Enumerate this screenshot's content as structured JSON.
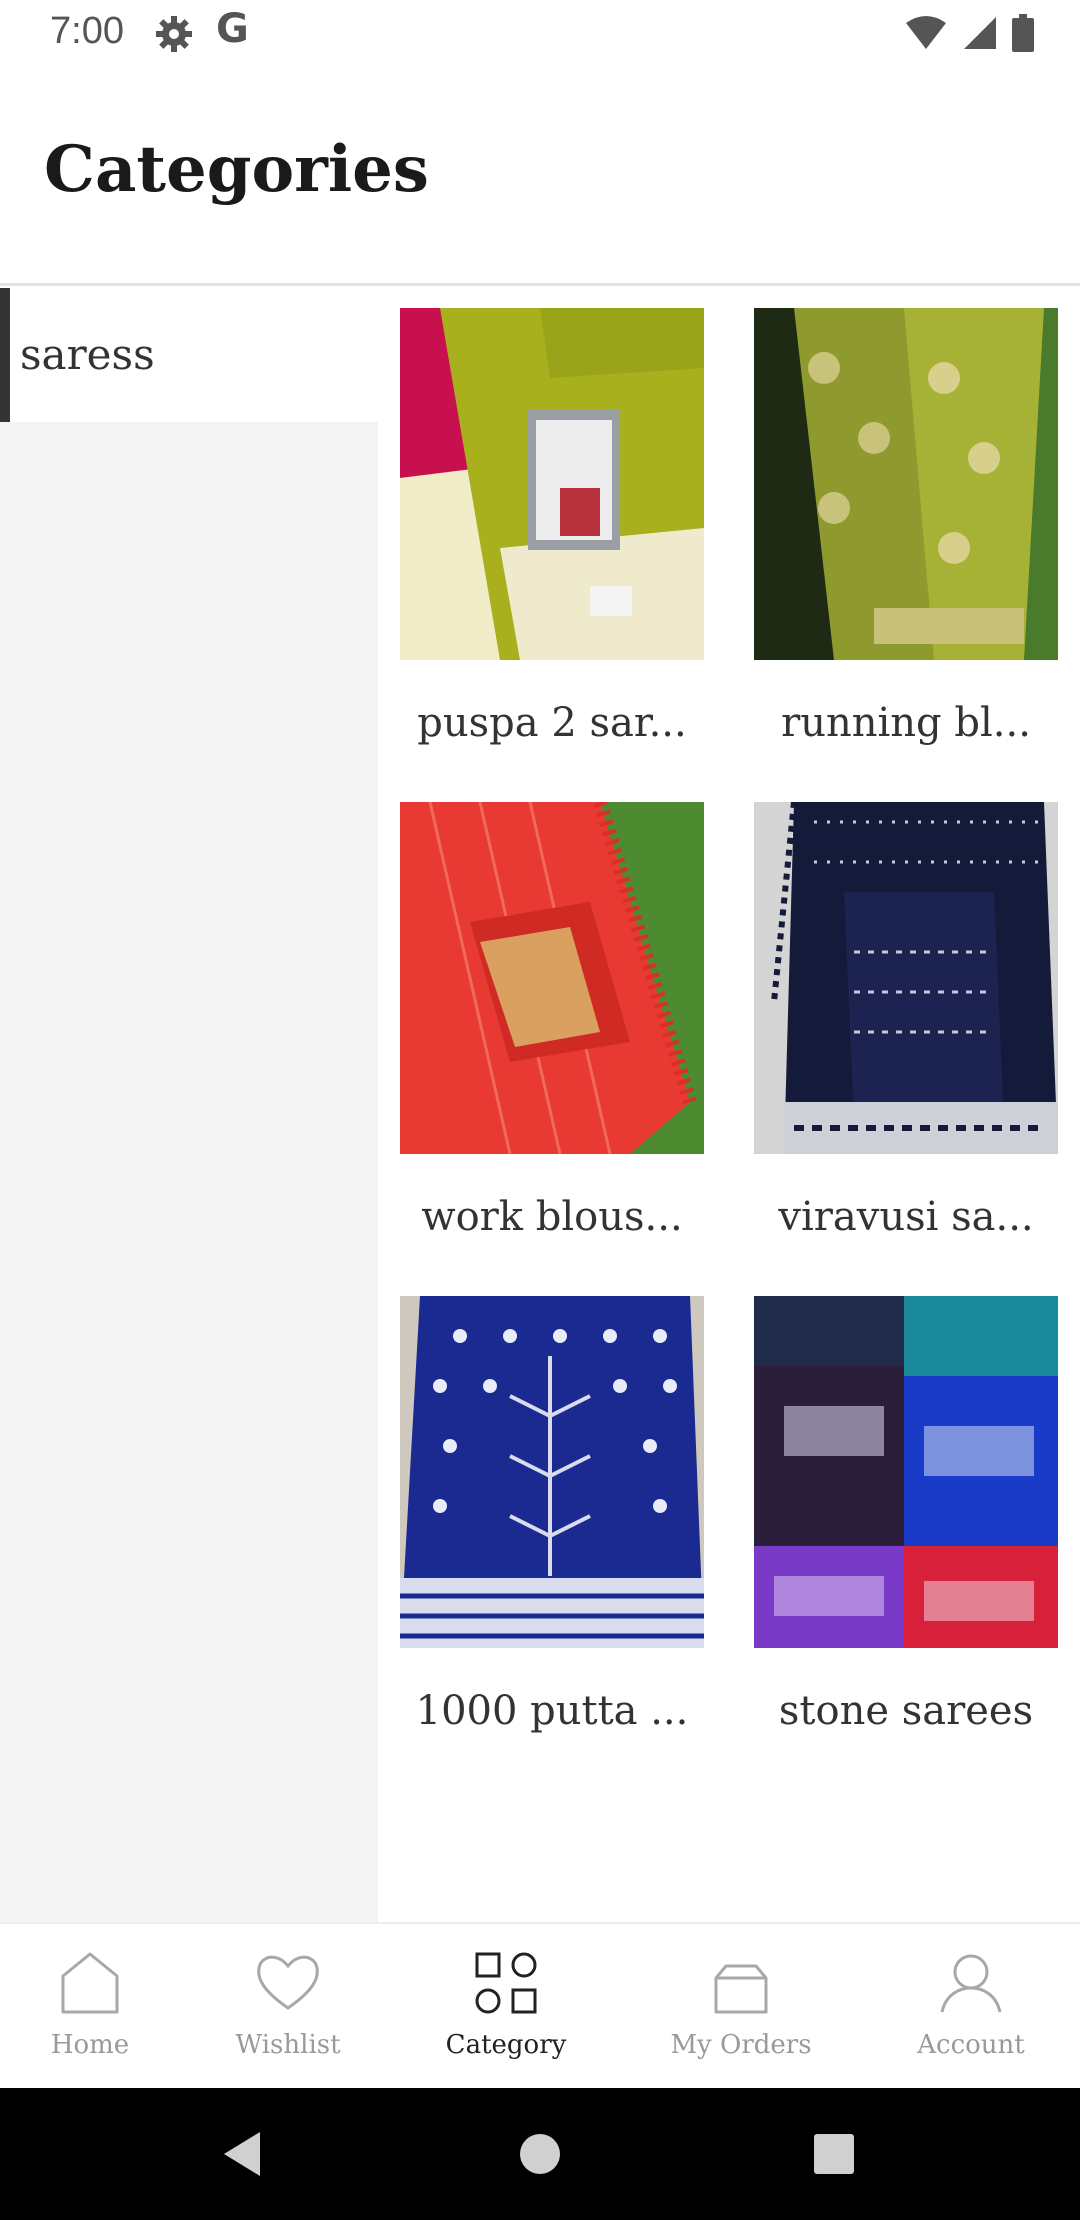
{
  "status_bar": {
    "time": "7:00",
    "left_icons": [
      "gear-icon",
      "google-icon"
    ],
    "google_glyph": "G",
    "right_icons": [
      "wifi-icon",
      "cell-signal-icon",
      "battery-icon"
    ]
  },
  "header": {
    "title": "Categories"
  },
  "sidebar": {
    "items": [
      {
        "label": "saress",
        "selected": true
      }
    ]
  },
  "products": [
    {
      "label": "puspa 2 sar..."
    },
    {
      "label": "running bl..."
    },
    {
      "label": "work blous..."
    },
    {
      "label": "viravusi sa..."
    },
    {
      "label": "1000 putta ..."
    },
    {
      "label": "stone sarees"
    }
  ],
  "bottom_nav": {
    "items": [
      {
        "label": "Home",
        "icon": "home-icon",
        "active": false
      },
      {
        "label": "Wishlist",
        "icon": "heart-icon",
        "active": false
      },
      {
        "label": "Category",
        "icon": "category-grid-icon",
        "active": true
      },
      {
        "label": "My Orders",
        "icon": "shopping-bag-icon",
        "active": false
      },
      {
        "label": "Account",
        "icon": "person-icon",
        "active": false
      }
    ]
  },
  "system_nav": {
    "icons": [
      "back-icon",
      "home-circle-icon",
      "recents-icon"
    ]
  },
  "colors": {
    "sidebar_bg": "#f4f4f4",
    "selected_accent": "#333333",
    "inactive_nav": "#9a9a9a",
    "active_nav": "#222222"
  }
}
